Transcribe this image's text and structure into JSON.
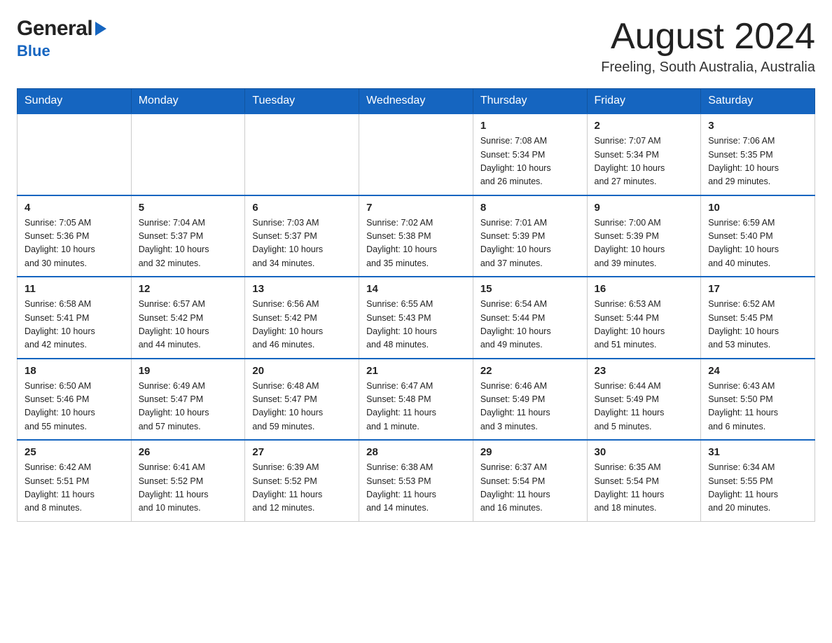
{
  "header": {
    "logo_general": "General",
    "logo_blue": "Blue",
    "month_title": "August 2024",
    "location": "Freeling, South Australia, Australia"
  },
  "days_of_week": [
    "Sunday",
    "Monday",
    "Tuesday",
    "Wednesday",
    "Thursday",
    "Friday",
    "Saturday"
  ],
  "weeks": [
    {
      "cells": [
        {
          "day": "",
          "info": ""
        },
        {
          "day": "",
          "info": ""
        },
        {
          "day": "",
          "info": ""
        },
        {
          "day": "",
          "info": ""
        },
        {
          "day": "1",
          "info": "Sunrise: 7:08 AM\nSunset: 5:34 PM\nDaylight: 10 hours\nand 26 minutes."
        },
        {
          "day": "2",
          "info": "Sunrise: 7:07 AM\nSunset: 5:34 PM\nDaylight: 10 hours\nand 27 minutes."
        },
        {
          "day": "3",
          "info": "Sunrise: 7:06 AM\nSunset: 5:35 PM\nDaylight: 10 hours\nand 29 minutes."
        }
      ]
    },
    {
      "cells": [
        {
          "day": "4",
          "info": "Sunrise: 7:05 AM\nSunset: 5:36 PM\nDaylight: 10 hours\nand 30 minutes."
        },
        {
          "day": "5",
          "info": "Sunrise: 7:04 AM\nSunset: 5:37 PM\nDaylight: 10 hours\nand 32 minutes."
        },
        {
          "day": "6",
          "info": "Sunrise: 7:03 AM\nSunset: 5:37 PM\nDaylight: 10 hours\nand 34 minutes."
        },
        {
          "day": "7",
          "info": "Sunrise: 7:02 AM\nSunset: 5:38 PM\nDaylight: 10 hours\nand 35 minutes."
        },
        {
          "day": "8",
          "info": "Sunrise: 7:01 AM\nSunset: 5:39 PM\nDaylight: 10 hours\nand 37 minutes."
        },
        {
          "day": "9",
          "info": "Sunrise: 7:00 AM\nSunset: 5:39 PM\nDaylight: 10 hours\nand 39 minutes."
        },
        {
          "day": "10",
          "info": "Sunrise: 6:59 AM\nSunset: 5:40 PM\nDaylight: 10 hours\nand 40 minutes."
        }
      ]
    },
    {
      "cells": [
        {
          "day": "11",
          "info": "Sunrise: 6:58 AM\nSunset: 5:41 PM\nDaylight: 10 hours\nand 42 minutes."
        },
        {
          "day": "12",
          "info": "Sunrise: 6:57 AM\nSunset: 5:42 PM\nDaylight: 10 hours\nand 44 minutes."
        },
        {
          "day": "13",
          "info": "Sunrise: 6:56 AM\nSunset: 5:42 PM\nDaylight: 10 hours\nand 46 minutes."
        },
        {
          "day": "14",
          "info": "Sunrise: 6:55 AM\nSunset: 5:43 PM\nDaylight: 10 hours\nand 48 minutes."
        },
        {
          "day": "15",
          "info": "Sunrise: 6:54 AM\nSunset: 5:44 PM\nDaylight: 10 hours\nand 49 minutes."
        },
        {
          "day": "16",
          "info": "Sunrise: 6:53 AM\nSunset: 5:44 PM\nDaylight: 10 hours\nand 51 minutes."
        },
        {
          "day": "17",
          "info": "Sunrise: 6:52 AM\nSunset: 5:45 PM\nDaylight: 10 hours\nand 53 minutes."
        }
      ]
    },
    {
      "cells": [
        {
          "day": "18",
          "info": "Sunrise: 6:50 AM\nSunset: 5:46 PM\nDaylight: 10 hours\nand 55 minutes."
        },
        {
          "day": "19",
          "info": "Sunrise: 6:49 AM\nSunset: 5:47 PM\nDaylight: 10 hours\nand 57 minutes."
        },
        {
          "day": "20",
          "info": "Sunrise: 6:48 AM\nSunset: 5:47 PM\nDaylight: 10 hours\nand 59 minutes."
        },
        {
          "day": "21",
          "info": "Sunrise: 6:47 AM\nSunset: 5:48 PM\nDaylight: 11 hours\nand 1 minute."
        },
        {
          "day": "22",
          "info": "Sunrise: 6:46 AM\nSunset: 5:49 PM\nDaylight: 11 hours\nand 3 minutes."
        },
        {
          "day": "23",
          "info": "Sunrise: 6:44 AM\nSunset: 5:49 PM\nDaylight: 11 hours\nand 5 minutes."
        },
        {
          "day": "24",
          "info": "Sunrise: 6:43 AM\nSunset: 5:50 PM\nDaylight: 11 hours\nand 6 minutes."
        }
      ]
    },
    {
      "cells": [
        {
          "day": "25",
          "info": "Sunrise: 6:42 AM\nSunset: 5:51 PM\nDaylight: 11 hours\nand 8 minutes."
        },
        {
          "day": "26",
          "info": "Sunrise: 6:41 AM\nSunset: 5:52 PM\nDaylight: 11 hours\nand 10 minutes."
        },
        {
          "day": "27",
          "info": "Sunrise: 6:39 AM\nSunset: 5:52 PM\nDaylight: 11 hours\nand 12 minutes."
        },
        {
          "day": "28",
          "info": "Sunrise: 6:38 AM\nSunset: 5:53 PM\nDaylight: 11 hours\nand 14 minutes."
        },
        {
          "day": "29",
          "info": "Sunrise: 6:37 AM\nSunset: 5:54 PM\nDaylight: 11 hours\nand 16 minutes."
        },
        {
          "day": "30",
          "info": "Sunrise: 6:35 AM\nSunset: 5:54 PM\nDaylight: 11 hours\nand 18 minutes."
        },
        {
          "day": "31",
          "info": "Sunrise: 6:34 AM\nSunset: 5:55 PM\nDaylight: 11 hours\nand 20 minutes."
        }
      ]
    }
  ]
}
